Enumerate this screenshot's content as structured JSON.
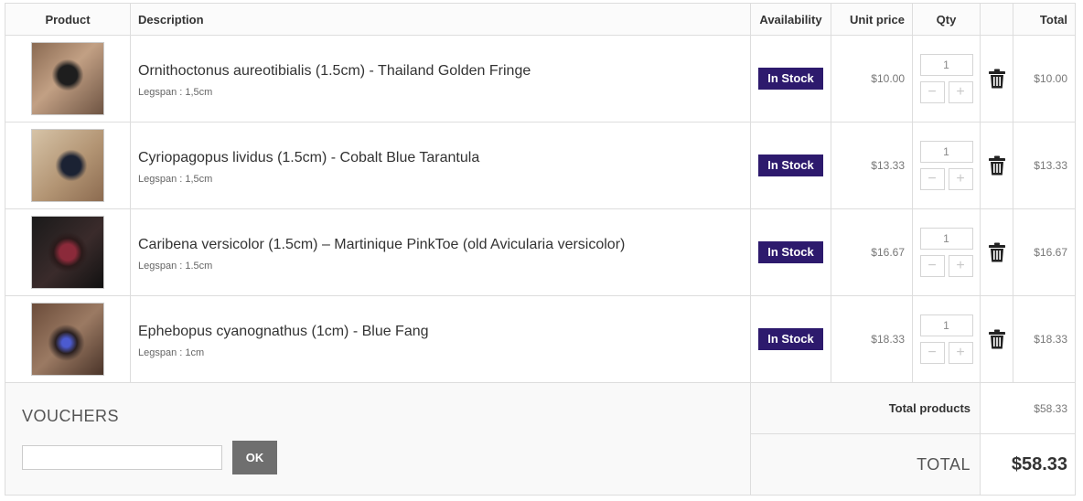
{
  "headers": {
    "product": "Product",
    "description": "Description",
    "availability": "Availability",
    "unit_price": "Unit price",
    "qty": "Qty",
    "delete": "",
    "total": "Total"
  },
  "items": [
    {
      "name": "Ornithoctonus aureotibialis (1.5cm) - Thailand Golden Fringe",
      "attribute": "Legspan : 1,5cm",
      "availability": "In Stock",
      "unit_price": "$10.00",
      "qty": "1",
      "total": "$10.00"
    },
    {
      "name": "Cyriopagopus lividus (1.5cm) - Cobalt Blue Tarantula",
      "attribute": "Legspan : 1,5cm",
      "availability": "In Stock",
      "unit_price": "$13.33",
      "qty": "1",
      "total": "$13.33"
    },
    {
      "name": "Caribena versicolor (1.5cm) – Martinique PinkToe (old Avicularia versicolor)",
      "attribute": "Legspan : 1.5cm",
      "availability": "In Stock",
      "unit_price": "$16.67",
      "qty": "1",
      "total": "$16.67"
    },
    {
      "name": "Ephebopus cyanognathus (1cm) - Blue Fang",
      "attribute": "Legspan : 1cm",
      "availability": "In Stock",
      "unit_price": "$18.33",
      "qty": "1",
      "total": "$18.33"
    }
  ],
  "qty_controls": {
    "minus": "−",
    "plus": "+"
  },
  "icons": {
    "delete": "trash-icon",
    "thumbnail": "product-image"
  },
  "colors": {
    "in_stock_badge": "#2d1a6d",
    "ok_button": "#6f6f6f"
  },
  "vouchers": {
    "title": "VOUCHERS",
    "input_value": "",
    "submit_label": "OK"
  },
  "summary": {
    "total_products_label": "Total products",
    "total_products_value": "$58.33",
    "total_label": "TOTAL",
    "total_value": "$58.33"
  }
}
